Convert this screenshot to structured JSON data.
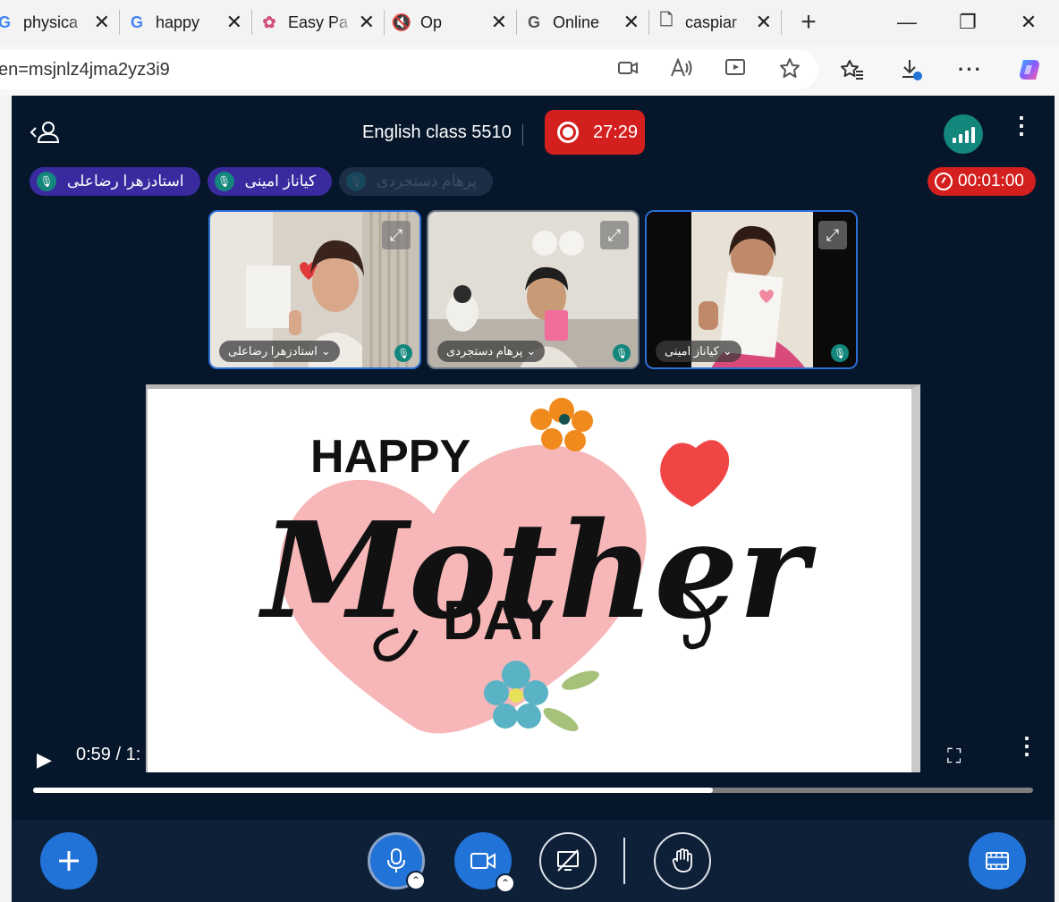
{
  "browser": {
    "tabs": [
      {
        "title": "physica",
        "icon": "google-icon",
        "icon_glyph": "G"
      },
      {
        "title": "happy",
        "icon": "google-icon",
        "icon_glyph": "G"
      },
      {
        "title": "Easy Pa",
        "icon": "pattern-icon",
        "icon_glyph": "✿"
      },
      {
        "title": "Op",
        "icon": "muted-speaker-icon",
        "icon_glyph": "🔇"
      },
      {
        "title": "Online",
        "icon": "g-icon",
        "icon_glyph": "G"
      },
      {
        "title": "caspiar",
        "icon": "document-icon",
        "icon_glyph": "🗋"
      }
    ],
    "close_glyph": "✕",
    "new_tab_glyph": "+",
    "url": "en=msjnlz4jma2yz3i9",
    "window": {
      "minimize": "—",
      "restore": "❐",
      "close": "✕"
    }
  },
  "meeting": {
    "title": "English class 5510",
    "recording_time": "27:29",
    "countdown": "00:01:00",
    "participants_chips": [
      {
        "name": "استادزهرا رضاعلی",
        "style": "purple"
      },
      {
        "name": "کیاناز امینی",
        "style": "purple"
      },
      {
        "name": "پرهام دستجردی",
        "style": "dim"
      }
    ],
    "tiles": [
      {
        "name": "استادزهرا رضاعلی",
        "active": true
      },
      {
        "name": "پرهام دستجردی",
        "active": false
      },
      {
        "name": "کیاناز امینی",
        "active": true
      }
    ],
    "video": {
      "time": "0:59 / 1:",
      "progress": 0.68
    },
    "slide": {
      "word1": "HAPPY",
      "word2": "Mother",
      "word3": "DAY"
    }
  },
  "colors": {
    "background": "#06172b",
    "record_red": "#d41f1f",
    "accent_blue": "#2273d8",
    "chip_purple": "#3a2aa0",
    "teal": "#14877c"
  }
}
